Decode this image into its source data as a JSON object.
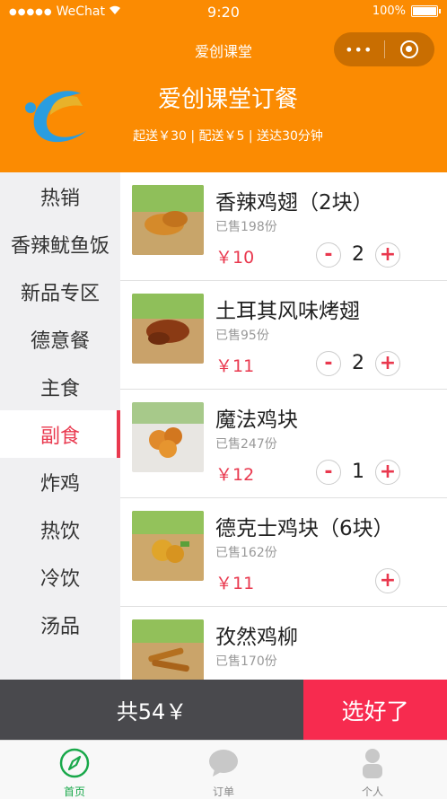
{
  "status_bar": {
    "carrier": "WeChat",
    "time": "9:20",
    "battery": "100%"
  },
  "nav": {
    "title": "爱创课堂",
    "more_icon": "more-dots-icon",
    "close_icon": "close-circle-icon"
  },
  "store": {
    "name": "爱创课堂订餐",
    "info": "起送￥30 | 配送￥5 | 送达30分钟"
  },
  "categories": [
    {
      "label": "热销"
    },
    {
      "label": "香辣鱿鱼饭"
    },
    {
      "label": "新品专区"
    },
    {
      "label": "德意餐"
    },
    {
      "label": "主食"
    },
    {
      "label": "副食",
      "active": true
    },
    {
      "label": "炸鸡"
    },
    {
      "label": "热饮"
    },
    {
      "label": "冷饮"
    },
    {
      "label": "汤品"
    }
  ],
  "foods": [
    {
      "name": "香辣鸡翅（2块）",
      "sold": "已售198份",
      "price": "￥10",
      "qty": "2",
      "minus": "-",
      "plus": "+"
    },
    {
      "name": "土耳其风味烤翅",
      "sold": "已售95份",
      "price": "￥11",
      "qty": "2",
      "minus": "-",
      "plus": "+"
    },
    {
      "name": "魔法鸡块",
      "sold": "已售247份",
      "price": "￥12",
      "qty": "1",
      "minus": "-",
      "plus": "+"
    },
    {
      "name": "德克士鸡块（6块）",
      "sold": "已售162份",
      "price": "￥11",
      "qty": "",
      "minus": "",
      "plus": "+"
    },
    {
      "name": "孜然鸡柳",
      "sold": "已售170份",
      "price": "",
      "qty": "",
      "minus": "",
      "plus": ""
    }
  ],
  "cart": {
    "total": "共54￥",
    "checkout": "选好了"
  },
  "tabs": [
    {
      "label": "首页",
      "icon": "compass-icon",
      "active": true
    },
    {
      "label": "订单",
      "icon": "chat-bubble-icon"
    },
    {
      "label": "个人",
      "icon": "person-icon"
    }
  ],
  "colors": {
    "brand": "#fb8b02",
    "accent": "#e9384e",
    "checkout": "#f72b4f",
    "tab_active": "#19a84a"
  }
}
